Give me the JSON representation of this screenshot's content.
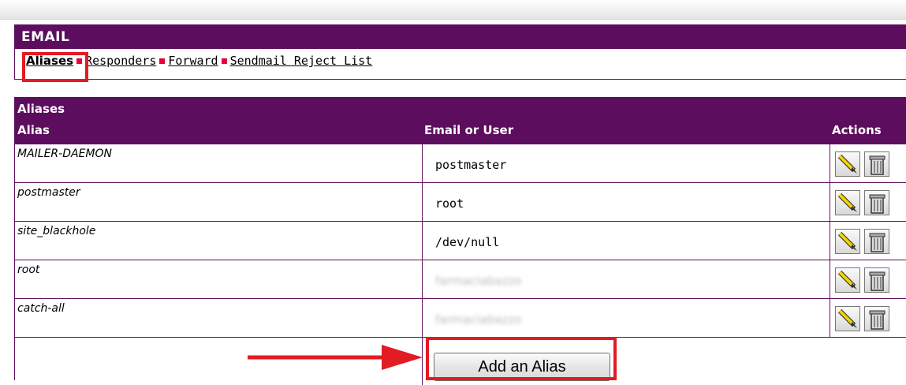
{
  "email": {
    "title": "EMAIL",
    "tabs": [
      {
        "label": "Aliases",
        "active": true
      },
      {
        "label": "Responders"
      },
      {
        "label": "Forward"
      },
      {
        "label": "Sendmail Reject List"
      }
    ]
  },
  "aliases": {
    "title": "Aliases",
    "columns": {
      "alias": "Alias",
      "target": "Email or User",
      "actions": "Actions"
    },
    "rows": [
      {
        "alias": "MAILER-DAEMON",
        "target": "postmaster"
      },
      {
        "alias": "postmaster",
        "target": "root"
      },
      {
        "alias": "site_blackhole",
        "target": "/dev/null"
      },
      {
        "alias": "root",
        "target": "farmaciabazzo"
      },
      {
        "alias": "catch-all",
        "target": "farmaciabazzo"
      }
    ],
    "add_button": "Add an Alias"
  },
  "colors": {
    "header": "#5d0d5d",
    "highlight": "#e31b23",
    "separator": "#e8003a"
  },
  "icons": [
    "pencil-icon",
    "trash-icon"
  ]
}
